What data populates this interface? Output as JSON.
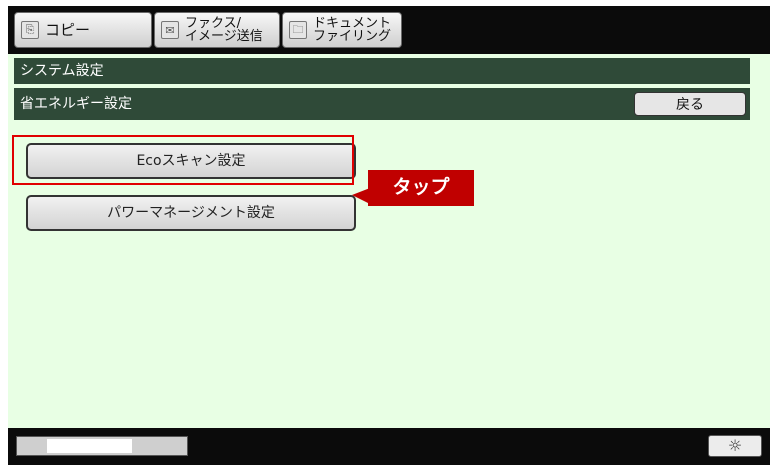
{
  "tabs": [
    {
      "label": "コピー",
      "icon": "copy-icon"
    },
    {
      "label": "ファクス/\nイメージ送信",
      "icon": "fax-icon"
    },
    {
      "label": "ドキュメント\nファイリング",
      "icon": "document-filing-icon"
    }
  ],
  "header": {
    "system": "システム設定",
    "section": "省エネルギー設定",
    "back_label": "戻る"
  },
  "buttons": {
    "eco_scan": "Ecoスキャン設定",
    "power_management": "パワーマネージメント設定"
  },
  "annotation": {
    "callout_text": "タップ",
    "color": "#c00000"
  },
  "footer": {
    "progress_fraction": 0.7,
    "brightness_icon": "sun-icon"
  },
  "colors": {
    "content_bg": "#e8ffe4",
    "header_bg": "#2f4a38"
  }
}
